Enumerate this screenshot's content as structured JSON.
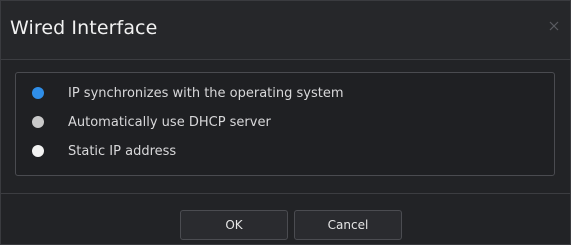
{
  "dialog": {
    "title": "Wired Interface",
    "close_icon": "close-icon"
  },
  "options": [
    {
      "label": "IP synchronizes with the operating system",
      "selected": true,
      "color": "#2f8ee8"
    },
    {
      "label": "Automatically use DHCP server",
      "selected": false,
      "color": "#c9c9c9"
    },
    {
      "label": "Static IP address",
      "selected": false,
      "color": "#f2f2f2"
    }
  ],
  "buttons": {
    "ok_label": "OK",
    "cancel_label": "Cancel"
  },
  "colors": {
    "accent": "#2f8ee8",
    "background": "#222326",
    "title_bar": "#26272a",
    "border": "#4a4b50"
  }
}
